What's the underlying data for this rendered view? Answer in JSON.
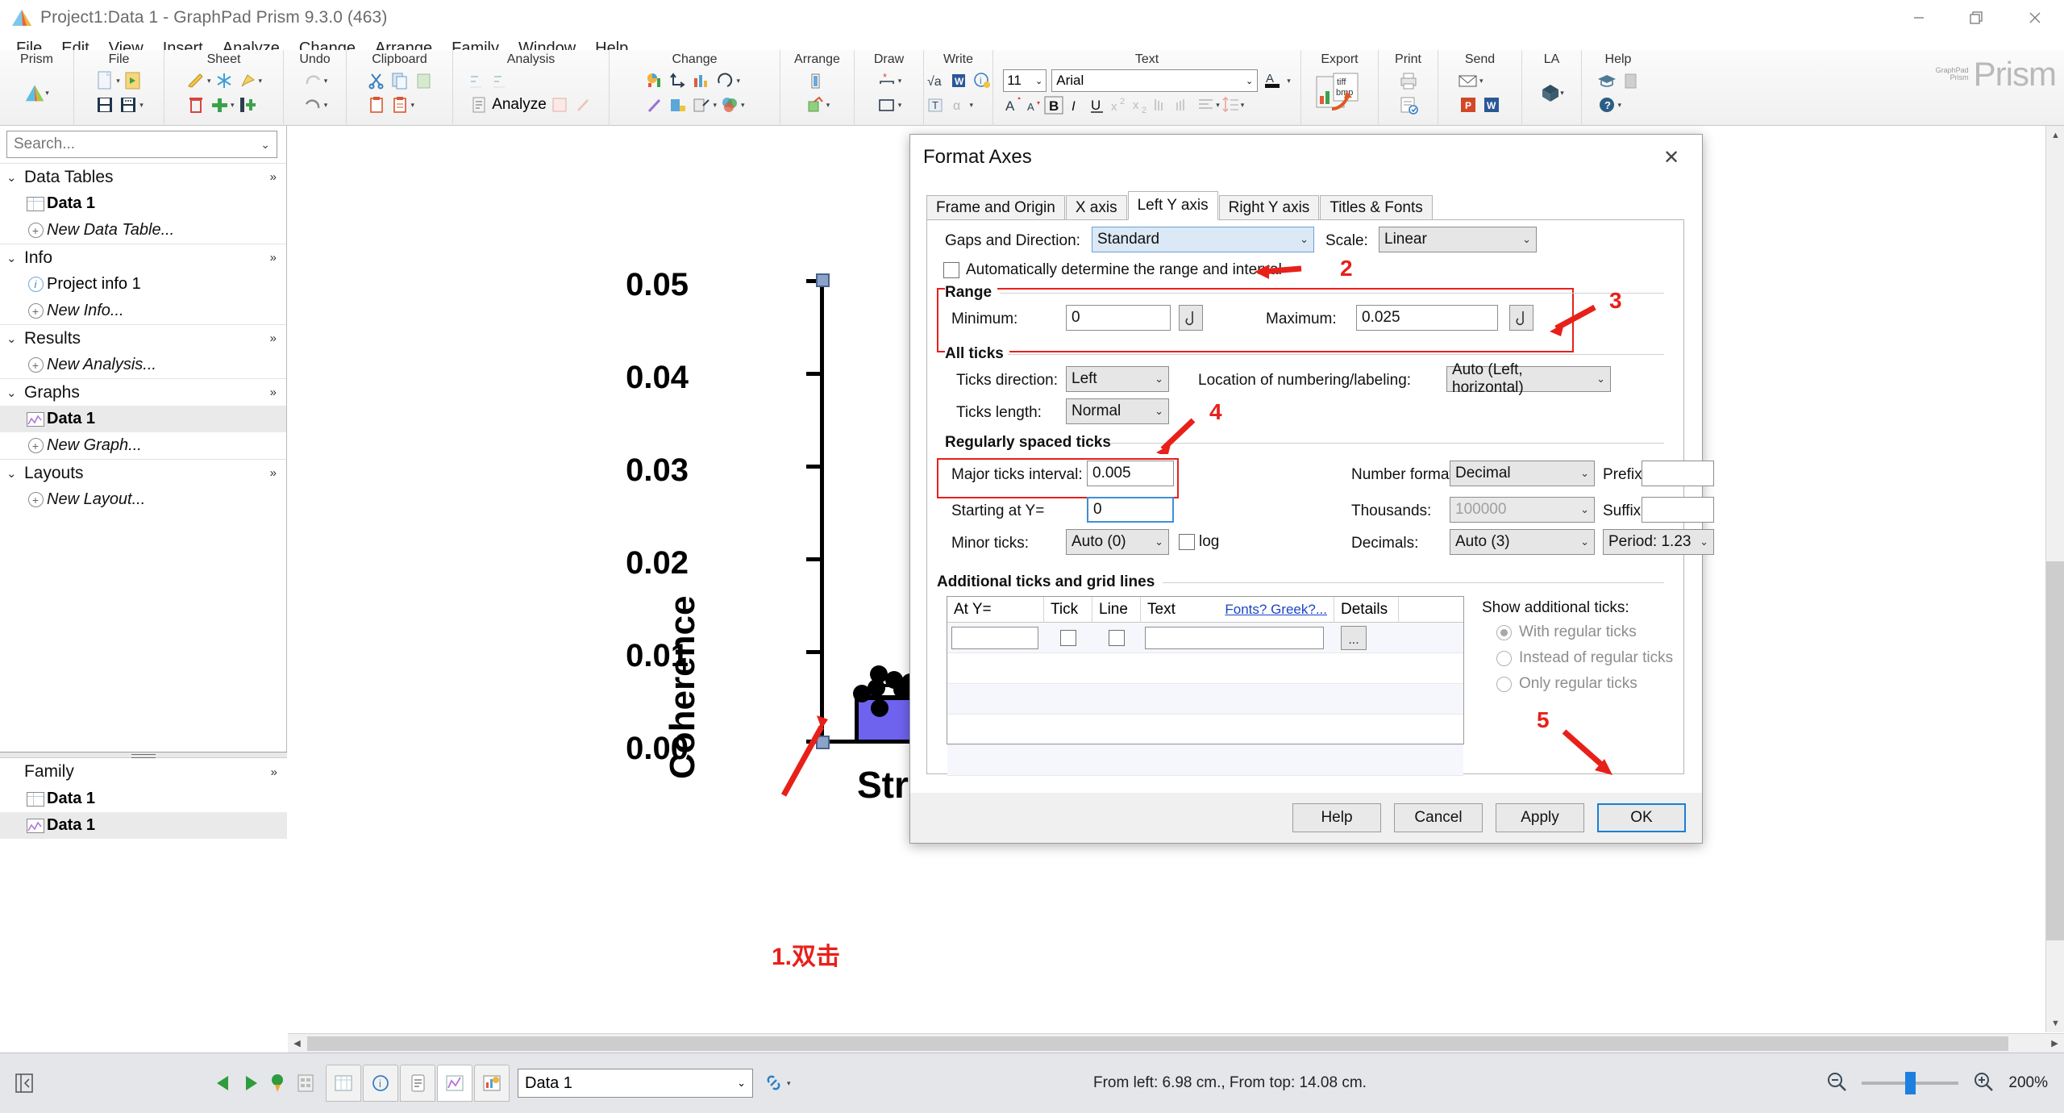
{
  "window": {
    "title": "Project1:Data 1 - GraphPad Prism 9.3.0 (463)",
    "minimize": "—",
    "maximize": "❐",
    "close": "✕"
  },
  "menubar": {
    "items": [
      "File",
      "Edit",
      "View",
      "Insert",
      "Analyze",
      "Change",
      "Arrange",
      "Family",
      "Window",
      "Help"
    ]
  },
  "ribbon": {
    "groups": [
      {
        "label": "Prism"
      },
      {
        "label": "File"
      },
      {
        "label": "Sheet"
      },
      {
        "label": "Undo"
      },
      {
        "label": "Clipboard"
      },
      {
        "label": "Analysis",
        "analyze_label": "Analyze"
      },
      {
        "label": "Change"
      },
      {
        "label": "Arrange"
      },
      {
        "label": "Draw"
      },
      {
        "label": "Write"
      },
      {
        "label": "Text"
      },
      {
        "label": "Export"
      },
      {
        "label": "Print"
      },
      {
        "label": "Send"
      },
      {
        "label": "LA"
      },
      {
        "label": "Help"
      }
    ],
    "font_size": "11",
    "font_name": "Arial",
    "export_icon_text_top": "tiff",
    "export_icon_text_bottom": "bmp",
    "brand": "Prism",
    "brand_sub_top": "GraphPad",
    "brand_sub_bottom": "Prism"
  },
  "sidebar": {
    "search_placeholder": "Search...",
    "sections": [
      {
        "label": "Data Tables",
        "items": [
          {
            "label": "Data 1",
            "icon": "table-icon",
            "style": "bold"
          },
          {
            "label": "New Data Table...",
            "icon": "plus-icon",
            "style": "italic"
          }
        ]
      },
      {
        "label": "Info",
        "items": [
          {
            "label": "Project info 1",
            "icon": "info-icon",
            "style": "normal"
          },
          {
            "label": "New Info...",
            "icon": "plus-icon",
            "style": "italic"
          }
        ]
      },
      {
        "label": "Results",
        "items": [
          {
            "label": "New Analysis...",
            "icon": "plus-icon",
            "style": "italic"
          }
        ]
      },
      {
        "label": "Graphs",
        "items": [
          {
            "label": "Data 1",
            "icon": "graph-icon",
            "style": "bold",
            "selected": true
          },
          {
            "label": "New Graph...",
            "icon": "plus-icon",
            "style": "italic"
          }
        ]
      },
      {
        "label": "Layouts",
        "items": [
          {
            "label": "New Layout...",
            "icon": "plus-icon",
            "style": "italic"
          }
        ]
      }
    ],
    "family": {
      "label": "Family",
      "items": [
        {
          "label": "Data 1",
          "icon": "table-icon",
          "selected": false
        },
        {
          "label": "Data 1",
          "icon": "graph-icon",
          "selected": true
        }
      ]
    }
  },
  "chart_data": {
    "type": "bar",
    "title": "",
    "xlabel": "Stro",
    "ylabel": "Coherence",
    "categories": [
      "Stro"
    ],
    "values": [
      0.0035
    ],
    "points": [
      0.0055,
      0.005,
      0.0048,
      0.0045,
      0.0042,
      0.004,
      0.0038,
      0.003
    ],
    "ytick_labels": [
      "0.05",
      "0.04",
      "0.03",
      "0.02",
      "0.01",
      "0.00"
    ],
    "ylim": [
      0.0,
      0.05
    ],
    "ytick_interval": 0.01,
    "grid": false,
    "legend": "none",
    "bar_color": "#6e63ee",
    "point_color": "#000000"
  },
  "annotations": [
    {
      "id": "1",
      "text": "1.双击"
    },
    {
      "id": "2",
      "text": "2"
    },
    {
      "id": "3",
      "text": "3"
    },
    {
      "id": "4",
      "text": "4"
    },
    {
      "id": "5",
      "text": "5"
    }
  ],
  "dialog": {
    "title": "Format Axes",
    "close": "✕",
    "tabs": [
      {
        "label": "Frame and Origin",
        "active": false
      },
      {
        "label": "X axis",
        "active": false
      },
      {
        "label": "Left Y axis",
        "active": true
      },
      {
        "label": "Right Y axis",
        "active": false
      },
      {
        "label": "Titles & Fonts",
        "active": false
      }
    ],
    "gaps_label": "Gaps and Direction:",
    "gaps_value": "Standard",
    "scale_label": "Scale:",
    "scale_value": "Linear",
    "auto_range_label": "Automatically determine the range and interval",
    "auto_range_checked": false,
    "range": {
      "group": "Range",
      "minimum_label": "Minimum:",
      "minimum_value": "0",
      "maximum_label": "Maximum:",
      "maximum_value": "0.025"
    },
    "all_ticks": {
      "group": "All ticks",
      "direction_label": "Ticks direction:",
      "direction_value": "Left",
      "length_label": "Ticks length:",
      "length_value": "Normal",
      "location_label": "Location of numbering/labeling:",
      "location_value": "Auto (Left, horizontal)"
    },
    "regular_ticks": {
      "group": "Regularly spaced ticks",
      "major_label": "Major ticks interval:",
      "major_value": "0.005",
      "starting_label": "Starting at Y=",
      "starting_value": "0",
      "minor_label": "Minor ticks:",
      "minor_value": "Auto (0)",
      "log_label": "log",
      "log_checked": false,
      "number_format_label": "Number format:",
      "number_format_value": "Decimal",
      "thousands_label": "Thousands:",
      "thousands_value": "100000",
      "decimals_label": "Decimals:",
      "decimals_value": "Auto (3)",
      "prefix_label": "Prefix:",
      "prefix_value": "",
      "suffix_label": "Suffix:",
      "suffix_value": "",
      "period_value": "Period: 1.23"
    },
    "additional": {
      "group": "Additional ticks and grid lines",
      "columns": [
        "At Y=",
        "Tick",
        "Line",
        "Text",
        "Details"
      ],
      "fonts_link": "Fonts? Greek?...",
      "row": {
        "at_y": "",
        "tick_checked": false,
        "line_checked": false,
        "text": "",
        "details": "..."
      },
      "show_label": "Show additional ticks:",
      "options": [
        {
          "label": "With regular ticks",
          "selected": true
        },
        {
          "label": "Instead of regular ticks",
          "selected": false
        },
        {
          "label": "Only regular ticks",
          "selected": false
        }
      ]
    },
    "buttons": {
      "help": "Help",
      "cancel": "Cancel",
      "apply": "Apply",
      "ok": "OK"
    }
  },
  "statusbar": {
    "sheet_value": "Data 1",
    "position_text": "From left: 6.98 cm., From top: 14.08 cm.",
    "zoom_level": "200%",
    "zoom_out_icon": "zoom-out-icon",
    "zoom_in_icon": "zoom-in-icon"
  }
}
